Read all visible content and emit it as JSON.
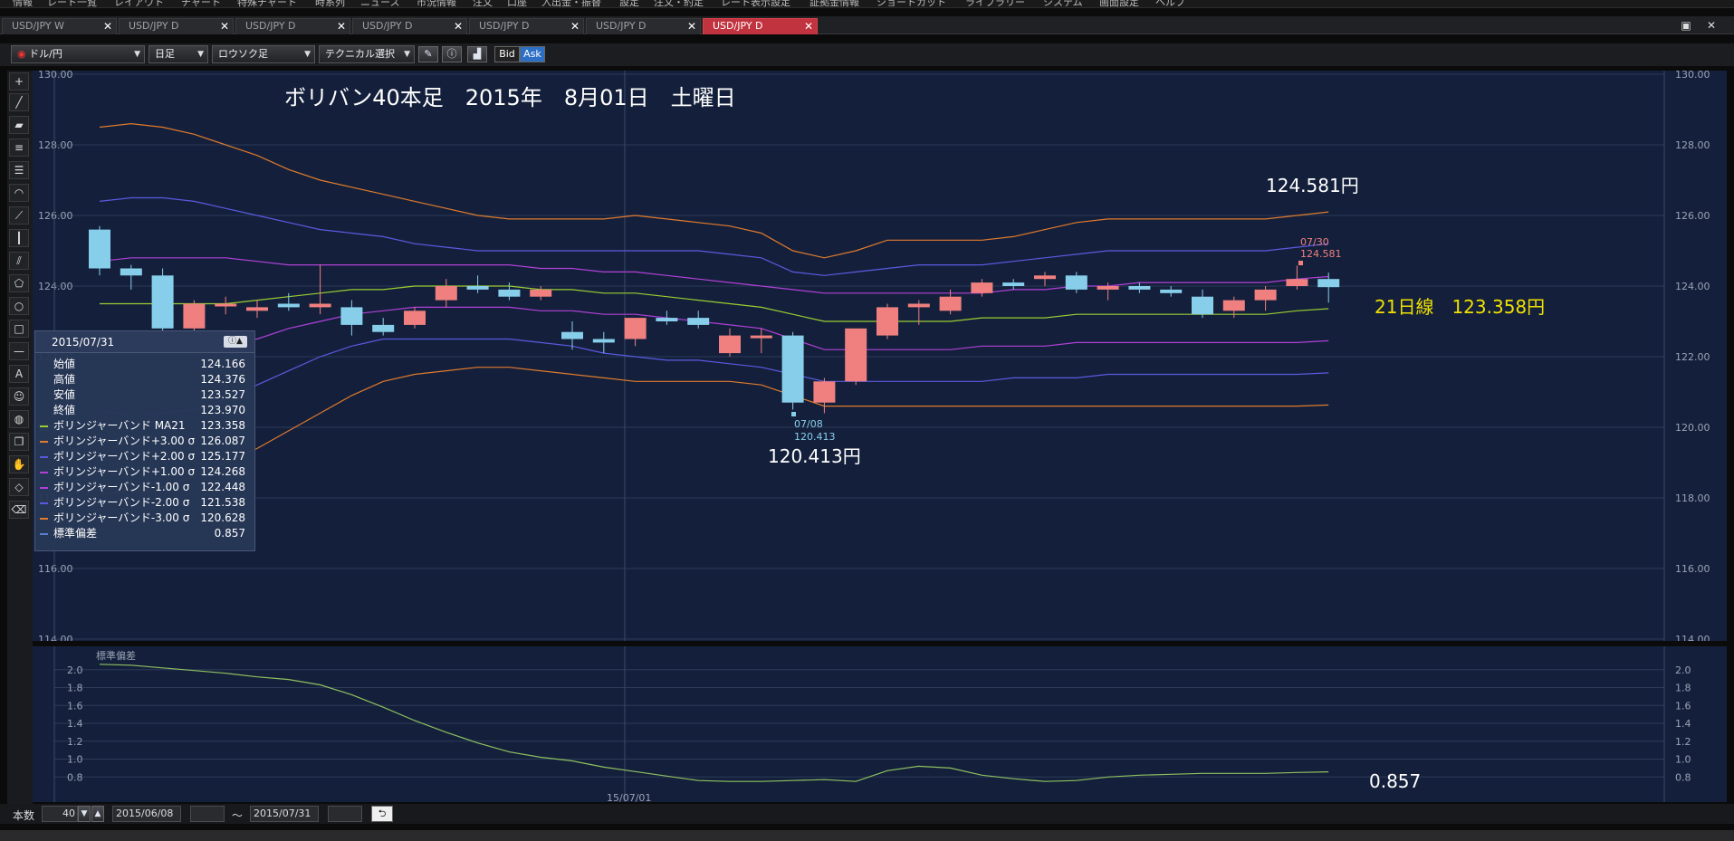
{
  "menu": {
    "items": [
      "情報",
      "レート一覧",
      "レイアウト",
      "チャート",
      "特殊チャート",
      "時系列",
      "ニュース",
      "市況情報",
      "注文",
      "口座",
      "入出金・振替",
      "設定",
      "注文・約定",
      "レート表示設定",
      "証拠金情報",
      "ショートカット",
      "ライブラリー",
      "システム",
      "画面設定",
      "ヘルプ"
    ]
  },
  "tabs": [
    {
      "label": "USD/JPY W",
      "active": false
    },
    {
      "label": "USD/JPY D",
      "active": false
    },
    {
      "label": "USD/JPY D",
      "active": false
    },
    {
      "label": "USD/JPY D",
      "active": false
    },
    {
      "label": "USD/JPY D",
      "active": false
    },
    {
      "label": "USD/JPY D",
      "active": false
    },
    {
      "label": "USD/JPY D",
      "active": true
    }
  ],
  "toolbar": {
    "pair": "ドル/円",
    "period": "日足",
    "chart_type": "ロウソク足",
    "technical": "テクニカル選択",
    "bid": "Bid",
    "ask": "Ask"
  },
  "colors": {
    "panel_bg": "#14203b",
    "up_candle": "#f08080",
    "down_candle": "#87ceeb",
    "ma21": "#9acd32",
    "plus3": "#e07a2e",
    "plus2": "#5a5ae0",
    "plus1": "#b040d8",
    "minus1": "#b040d8",
    "minus2": "#5a5ae0",
    "minus3": "#e07a2e",
    "stddev": "#8fc060"
  },
  "chart_data": {
    "type": "candlestick",
    "annotations": {
      "title": "ボリバン40本足　2015年　8月01日　土曜日",
      "upper_price": "124.581円",
      "ma_label": "21日線　123.358円",
      "low_price": "120.413円",
      "low_date": "07/08",
      "low_value": "120.413",
      "high_date": "07/30",
      "high_value": "124.581",
      "stddev_value": "0.857"
    },
    "y_axis": {
      "min": 114,
      "max": 130,
      "ticks": [
        "130.00",
        "128.00",
        "126.00",
        "124.00",
        "122.00",
        "120.00",
        "118.00",
        "116.00",
        "114.00"
      ]
    },
    "sub_axis": {
      "min": 0.6,
      "max": 2.2,
      "ticks": [
        "2.0",
        "1.8",
        "1.6",
        "1.4",
        "1.2",
        "1.0",
        "0.8"
      ],
      "title": "標準偏差"
    },
    "x_label": "15/07/01",
    "candles": [
      {
        "o": 125.6,
        "h": 125.7,
        "l": 124.3,
        "c": 124.5
      },
      {
        "o": 124.5,
        "h": 124.6,
        "l": 123.9,
        "c": 124.3
      },
      {
        "o": 124.3,
        "h": 124.5,
        "l": 122.5,
        "c": 122.8
      },
      {
        "o": 122.8,
        "h": 123.6,
        "l": 122.7,
        "c": 123.5
      },
      {
        "o": 123.5,
        "h": 123.7,
        "l": 123.2,
        "c": 123.5
      },
      {
        "o": 123.3,
        "h": 123.6,
        "l": 123.1,
        "c": 123.4
      },
      {
        "o": 123.5,
        "h": 123.8,
        "l": 123.3,
        "c": 123.4
      },
      {
        "o": 123.4,
        "h": 124.6,
        "l": 123.2,
        "c": 123.5
      },
      {
        "o": 123.4,
        "h": 123.6,
        "l": 122.6,
        "c": 122.9
      },
      {
        "o": 122.9,
        "h": 123.1,
        "l": 122.6,
        "c": 122.7
      },
      {
        "o": 122.9,
        "h": 123.4,
        "l": 122.8,
        "c": 123.3
      },
      {
        "o": 123.6,
        "h": 124.2,
        "l": 123.4,
        "c": 124.0
      },
      {
        "o": 124.0,
        "h": 124.3,
        "l": 123.8,
        "c": 123.9
      },
      {
        "o": 123.9,
        "h": 124.1,
        "l": 123.6,
        "c": 123.7
      },
      {
        "o": 123.7,
        "h": 124.0,
        "l": 123.6,
        "c": 123.9
      },
      {
        "o": 122.7,
        "h": 123.0,
        "l": 122.2,
        "c": 122.5
      },
      {
        "o": 122.5,
        "h": 122.7,
        "l": 122.1,
        "c": 122.4
      },
      {
        "o": 122.5,
        "h": 123.0,
        "l": 122.3,
        "c": 123.1
      },
      {
        "o": 123.1,
        "h": 123.3,
        "l": 122.9,
        "c": 123.0
      },
      {
        "o": 123.1,
        "h": 123.3,
        "l": 122.8,
        "c": 122.9
      },
      {
        "o": 122.1,
        "h": 122.8,
        "l": 122.0,
        "c": 122.6
      },
      {
        "o": 122.6,
        "h": 122.8,
        "l": 122.1,
        "c": 122.6
      },
      {
        "o": 122.6,
        "h": 122.7,
        "l": 120.5,
        "c": 120.7
      },
      {
        "o": 120.7,
        "h": 121.4,
        "l": 120.4,
        "c": 121.3
      },
      {
        "o": 121.3,
        "h": 122.8,
        "l": 121.2,
        "c": 122.8
      },
      {
        "o": 122.6,
        "h": 123.5,
        "l": 122.5,
        "c": 123.4
      },
      {
        "o": 123.4,
        "h": 123.6,
        "l": 122.9,
        "c": 123.5
      },
      {
        "o": 123.3,
        "h": 123.9,
        "l": 123.2,
        "c": 123.7
      },
      {
        "o": 123.8,
        "h": 124.2,
        "l": 123.7,
        "c": 124.1
      },
      {
        "o": 124.1,
        "h": 124.2,
        "l": 123.9,
        "c": 124.0
      },
      {
        "o": 124.2,
        "h": 124.4,
        "l": 124.0,
        "c": 124.3
      },
      {
        "o": 124.3,
        "h": 124.4,
        "l": 123.8,
        "c": 123.9
      },
      {
        "o": 123.9,
        "h": 124.1,
        "l": 123.6,
        "c": 124.0
      },
      {
        "o": 124.0,
        "h": 124.1,
        "l": 123.8,
        "c": 123.9
      },
      {
        "o": 123.9,
        "h": 124.0,
        "l": 123.7,
        "c": 123.8
      },
      {
        "o": 123.7,
        "h": 123.9,
        "l": 123.1,
        "c": 123.2
      },
      {
        "o": 123.3,
        "h": 123.7,
        "l": 123.1,
        "c": 123.6
      },
      {
        "o": 123.6,
        "h": 124.0,
        "l": 123.3,
        "c": 123.9
      },
      {
        "o": 124.0,
        "h": 124.58,
        "l": 123.9,
        "c": 124.2
      },
      {
        "o": 124.2,
        "h": 124.38,
        "l": 123.53,
        "c": 123.97
      }
    ],
    "bands": {
      "plus3": [
        128.5,
        128.6,
        128.5,
        128.3,
        128.0,
        127.7,
        127.3,
        127.0,
        126.8,
        126.6,
        126.4,
        126.2,
        126.0,
        125.9,
        125.9,
        125.9,
        125.9,
        126.0,
        125.9,
        125.8,
        125.7,
        125.5,
        125.0,
        124.8,
        125.0,
        125.3,
        125.3,
        125.3,
        125.3,
        125.4,
        125.6,
        125.8,
        125.9,
        125.9,
        125.9,
        125.9,
        125.9,
        125.9,
        126.0,
        126.1
      ],
      "plus2": [
        126.4,
        126.5,
        126.5,
        126.4,
        126.2,
        126.0,
        125.8,
        125.6,
        125.5,
        125.4,
        125.2,
        125.1,
        125.0,
        125.0,
        125.0,
        125.0,
        125.0,
        125.0,
        125.0,
        125.0,
        124.9,
        124.8,
        124.4,
        124.3,
        124.4,
        124.5,
        124.6,
        124.6,
        124.6,
        124.7,
        124.8,
        124.9,
        125.0,
        125.0,
        125.0,
        125.0,
        125.0,
        125.0,
        125.1,
        125.2
      ],
      "ma21": [
        123.5,
        123.5,
        123.5,
        123.5,
        123.5,
        123.6,
        123.7,
        123.8,
        123.9,
        123.9,
        124.0,
        124.0,
        124.0,
        124.0,
        123.9,
        123.9,
        123.8,
        123.8,
        123.7,
        123.6,
        123.5,
        123.4,
        123.2,
        123.0,
        123.0,
        123.0,
        123.0,
        123.0,
        123.1,
        123.1,
        123.1,
        123.2,
        123.2,
        123.2,
        123.2,
        123.2,
        123.2,
        123.2,
        123.3,
        123.36
      ],
      "plus1": [
        124.7,
        124.8,
        124.8,
        124.8,
        124.8,
        124.7,
        124.6,
        124.6,
        124.6,
        124.6,
        124.6,
        124.6,
        124.6,
        124.6,
        124.5,
        124.5,
        124.4,
        124.4,
        124.3,
        124.2,
        124.1,
        124.0,
        123.9,
        123.8,
        123.8,
        123.8,
        123.8,
        123.8,
        123.8,
        123.9,
        123.9,
        124.0,
        124.0,
        124.1,
        124.1,
        124.1,
        124.1,
        124.1,
        124.2,
        124.27
      ],
      "minus1": [
        122.3,
        122.2,
        122.2,
        122.3,
        122.4,
        122.5,
        122.8,
        123.0,
        123.2,
        123.3,
        123.4,
        123.4,
        123.4,
        123.4,
        123.3,
        123.3,
        123.2,
        123.2,
        123.1,
        123.0,
        122.9,
        122.8,
        122.5,
        122.2,
        122.2,
        122.2,
        122.2,
        122.2,
        122.3,
        122.3,
        122.3,
        122.4,
        122.4,
        122.4,
        122.4,
        122.4,
        122.4,
        122.4,
        122.4,
        122.45
      ],
      "minus2": [
        120.5,
        120.3,
        120.4,
        120.5,
        120.8,
        121.2,
        121.6,
        122.0,
        122.3,
        122.5,
        122.5,
        122.5,
        122.5,
        122.5,
        122.4,
        122.3,
        122.1,
        122.0,
        121.9,
        121.9,
        121.8,
        121.7,
        121.5,
        121.3,
        121.3,
        121.3,
        121.3,
        121.3,
        121.3,
        121.4,
        121.4,
        121.4,
        121.5,
        121.5,
        121.5,
        121.5,
        121.5,
        121.5,
        121.5,
        121.54
      ],
      "minus3": [
        118.1,
        118.2,
        118.3,
        118.6,
        119.0,
        119.4,
        119.9,
        120.4,
        120.9,
        121.3,
        121.5,
        121.6,
        121.7,
        121.7,
        121.6,
        121.5,
        121.4,
        121.3,
        121.3,
        121.3,
        121.3,
        121.2,
        120.9,
        120.6,
        120.6,
        120.6,
        120.6,
        120.6,
        120.6,
        120.6,
        120.6,
        120.6,
        120.6,
        120.6,
        120.6,
        120.6,
        120.6,
        120.6,
        120.6,
        120.63
      ]
    },
    "stddev": [
      2.06,
      2.05,
      2.02,
      1.99,
      1.96,
      1.92,
      1.89,
      1.83,
      1.72,
      1.58,
      1.43,
      1.3,
      1.18,
      1.08,
      1.02,
      0.98,
      0.91,
      0.86,
      0.81,
      0.76,
      0.75,
      0.75,
      0.76,
      0.77,
      0.75,
      0.87,
      0.92,
      0.9,
      0.82,
      0.78,
      0.75,
      0.76,
      0.8,
      0.82,
      0.83,
      0.84,
      0.84,
      0.84,
      0.85,
      0.857
    ]
  },
  "datawindow": {
    "date": "2015/07/31",
    "rows": [
      {
        "label": "始値",
        "value": "124.166",
        "swatch": ""
      },
      {
        "label": "高値",
        "value": "124.376",
        "swatch": ""
      },
      {
        "label": "安値",
        "value": "123.527",
        "swatch": ""
      },
      {
        "label": "終値",
        "value": "123.970",
        "swatch": ""
      },
      {
        "label": "ボリンジャーバンド MA21",
        "value": "123.358",
        "swatch": "#9acd32"
      },
      {
        "label": "ボリンジャーバンド+3.00 σ",
        "value": "126.087",
        "swatch": "#e07a2e"
      },
      {
        "label": "ボリンジャーバンド+2.00 σ",
        "value": "125.177",
        "swatch": "#5a5ae0"
      },
      {
        "label": "ボリンジャーバンド+1.00 σ",
        "value": "124.268",
        "swatch": "#b040d8"
      },
      {
        "label": "ボリンジャーバンド-1.00 σ",
        "value": "122.448",
        "swatch": "#b040d8"
      },
      {
        "label": "ボリンジャーバンド-2.00 σ",
        "value": "121.538",
        "swatch": "#5a5ae0"
      },
      {
        "label": "ボリンジャーバンド-3.00 σ",
        "value": "120.628",
        "swatch": "#e07a2e"
      },
      {
        "label": "標準偏差",
        "value": "0.857",
        "swatch": "#5a7fd0"
      }
    ]
  },
  "status": {
    "count_label": "本数",
    "count_value": "40",
    "from_date": "2015/06/08",
    "tilde": "〜",
    "to_date": "2015/07/31"
  }
}
